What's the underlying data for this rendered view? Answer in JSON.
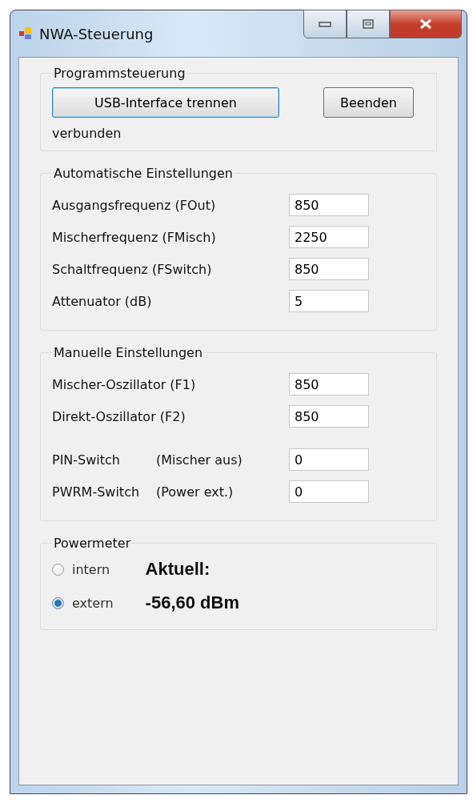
{
  "window": {
    "title": "NWA-Steuerung"
  },
  "program_control": {
    "title": "Programmsteuerung",
    "buttons": [
      {
        "label": "USB-Interface trennen",
        "focused": true
      },
      {
        "label": "Beenden",
        "focused": false
      }
    ],
    "status": "verbunden"
  },
  "automatic_settings": {
    "title": "Automatische Einstellungen",
    "fields": [
      {
        "label": "Ausgangsfrequenz (FOut)",
        "value": "850"
      },
      {
        "label": "Mischerfrequenz (FMisch)",
        "value": "2250"
      },
      {
        "label": "Schaltfrequenz (FSwitch)",
        "value": "850"
      },
      {
        "label": "Attenuator (dB)",
        "value": "5"
      }
    ]
  },
  "manual_settings": {
    "title": "Manuelle Einstellungen",
    "fields": [
      {
        "label": "Mischer-Oszillator (F1)",
        "value": "850"
      },
      {
        "label": "Direkt-Oszillator (F2)",
        "value": "850"
      },
      {
        "label": "PIN-Switch",
        "note": "(Mischer aus)",
        "value": "0"
      },
      {
        "label": "PWRM-Switch",
        "note": "(Power ext.)",
        "value": "0"
      }
    ]
  },
  "powermeter": {
    "title": "Powermeter",
    "options": [
      {
        "label": "intern",
        "selected": false
      },
      {
        "label": "extern",
        "selected": true
      }
    ],
    "reading_label": "Aktuell:",
    "reading": "-56,60 dBm"
  }
}
